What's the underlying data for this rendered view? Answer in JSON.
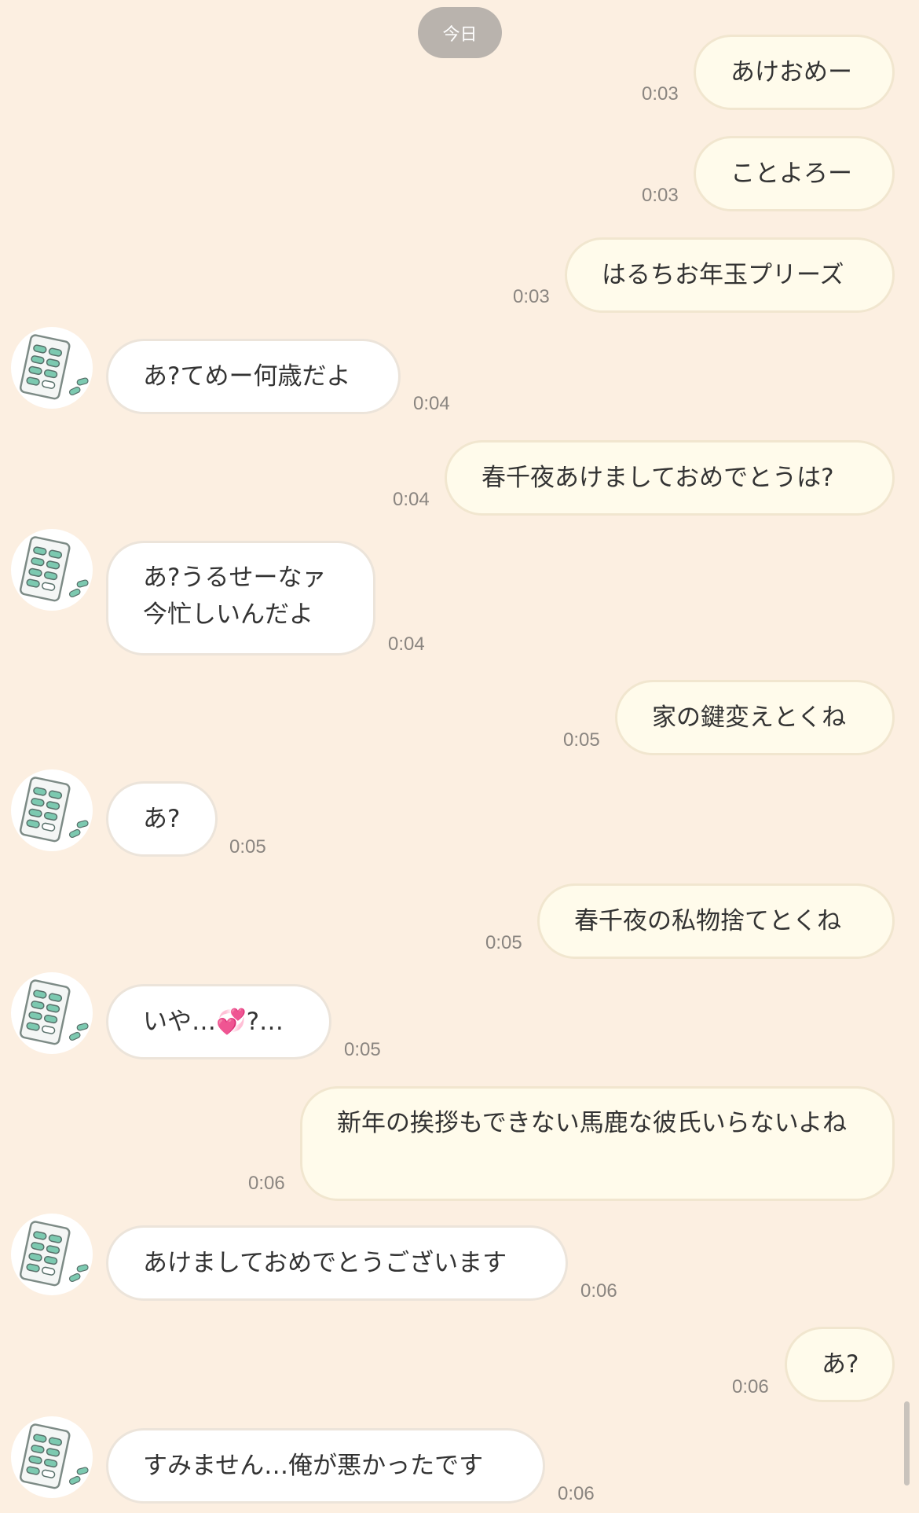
{
  "date_label": "今日",
  "messages": [
    {
      "side": "right",
      "text": "あけおめー",
      "time": "0:03"
    },
    {
      "side": "right",
      "text": "ことよろー",
      "time": "0:03"
    },
    {
      "side": "right",
      "text": "はるちお年玉プリーズ",
      "time": "0:03"
    },
    {
      "side": "left",
      "text": "あ?てめー何歳だよ",
      "time": "0:04"
    },
    {
      "side": "right",
      "text": "春千夜あけましておめでとうは?",
      "time": "0:04"
    },
    {
      "side": "left",
      "text": "あ?うるせーなァ\n今忙しいんだよ",
      "time": "0:04"
    },
    {
      "side": "right",
      "text": "家の鍵変えとくね",
      "time": "0:05"
    },
    {
      "side": "left",
      "text": "あ?",
      "time": "0:05"
    },
    {
      "side": "right",
      "text": "春千夜の私物捨てとくね",
      "time": "0:05"
    },
    {
      "side": "left",
      "text": "いや…💞?…",
      "time": "0:05"
    },
    {
      "side": "right",
      "text": "新年の挨拶もできない馬鹿な彼氏いらないよね",
      "time": "0:06"
    },
    {
      "side": "left",
      "text": "あけましておめでとうございます",
      "time": "0:06"
    },
    {
      "side": "right",
      "text": "あ?",
      "time": "0:06"
    },
    {
      "side": "left",
      "text": "すみません…俺が悪かったです",
      "time": "0:06"
    }
  ],
  "avatar_icon": "pill-blister-pack-icon",
  "colors": {
    "background": "#fcefe1",
    "bubble_sent": "#fffbeb",
    "bubble_received": "#ffffff",
    "timestamp": "#8a8580",
    "date_pill": "#b9b3ad"
  }
}
